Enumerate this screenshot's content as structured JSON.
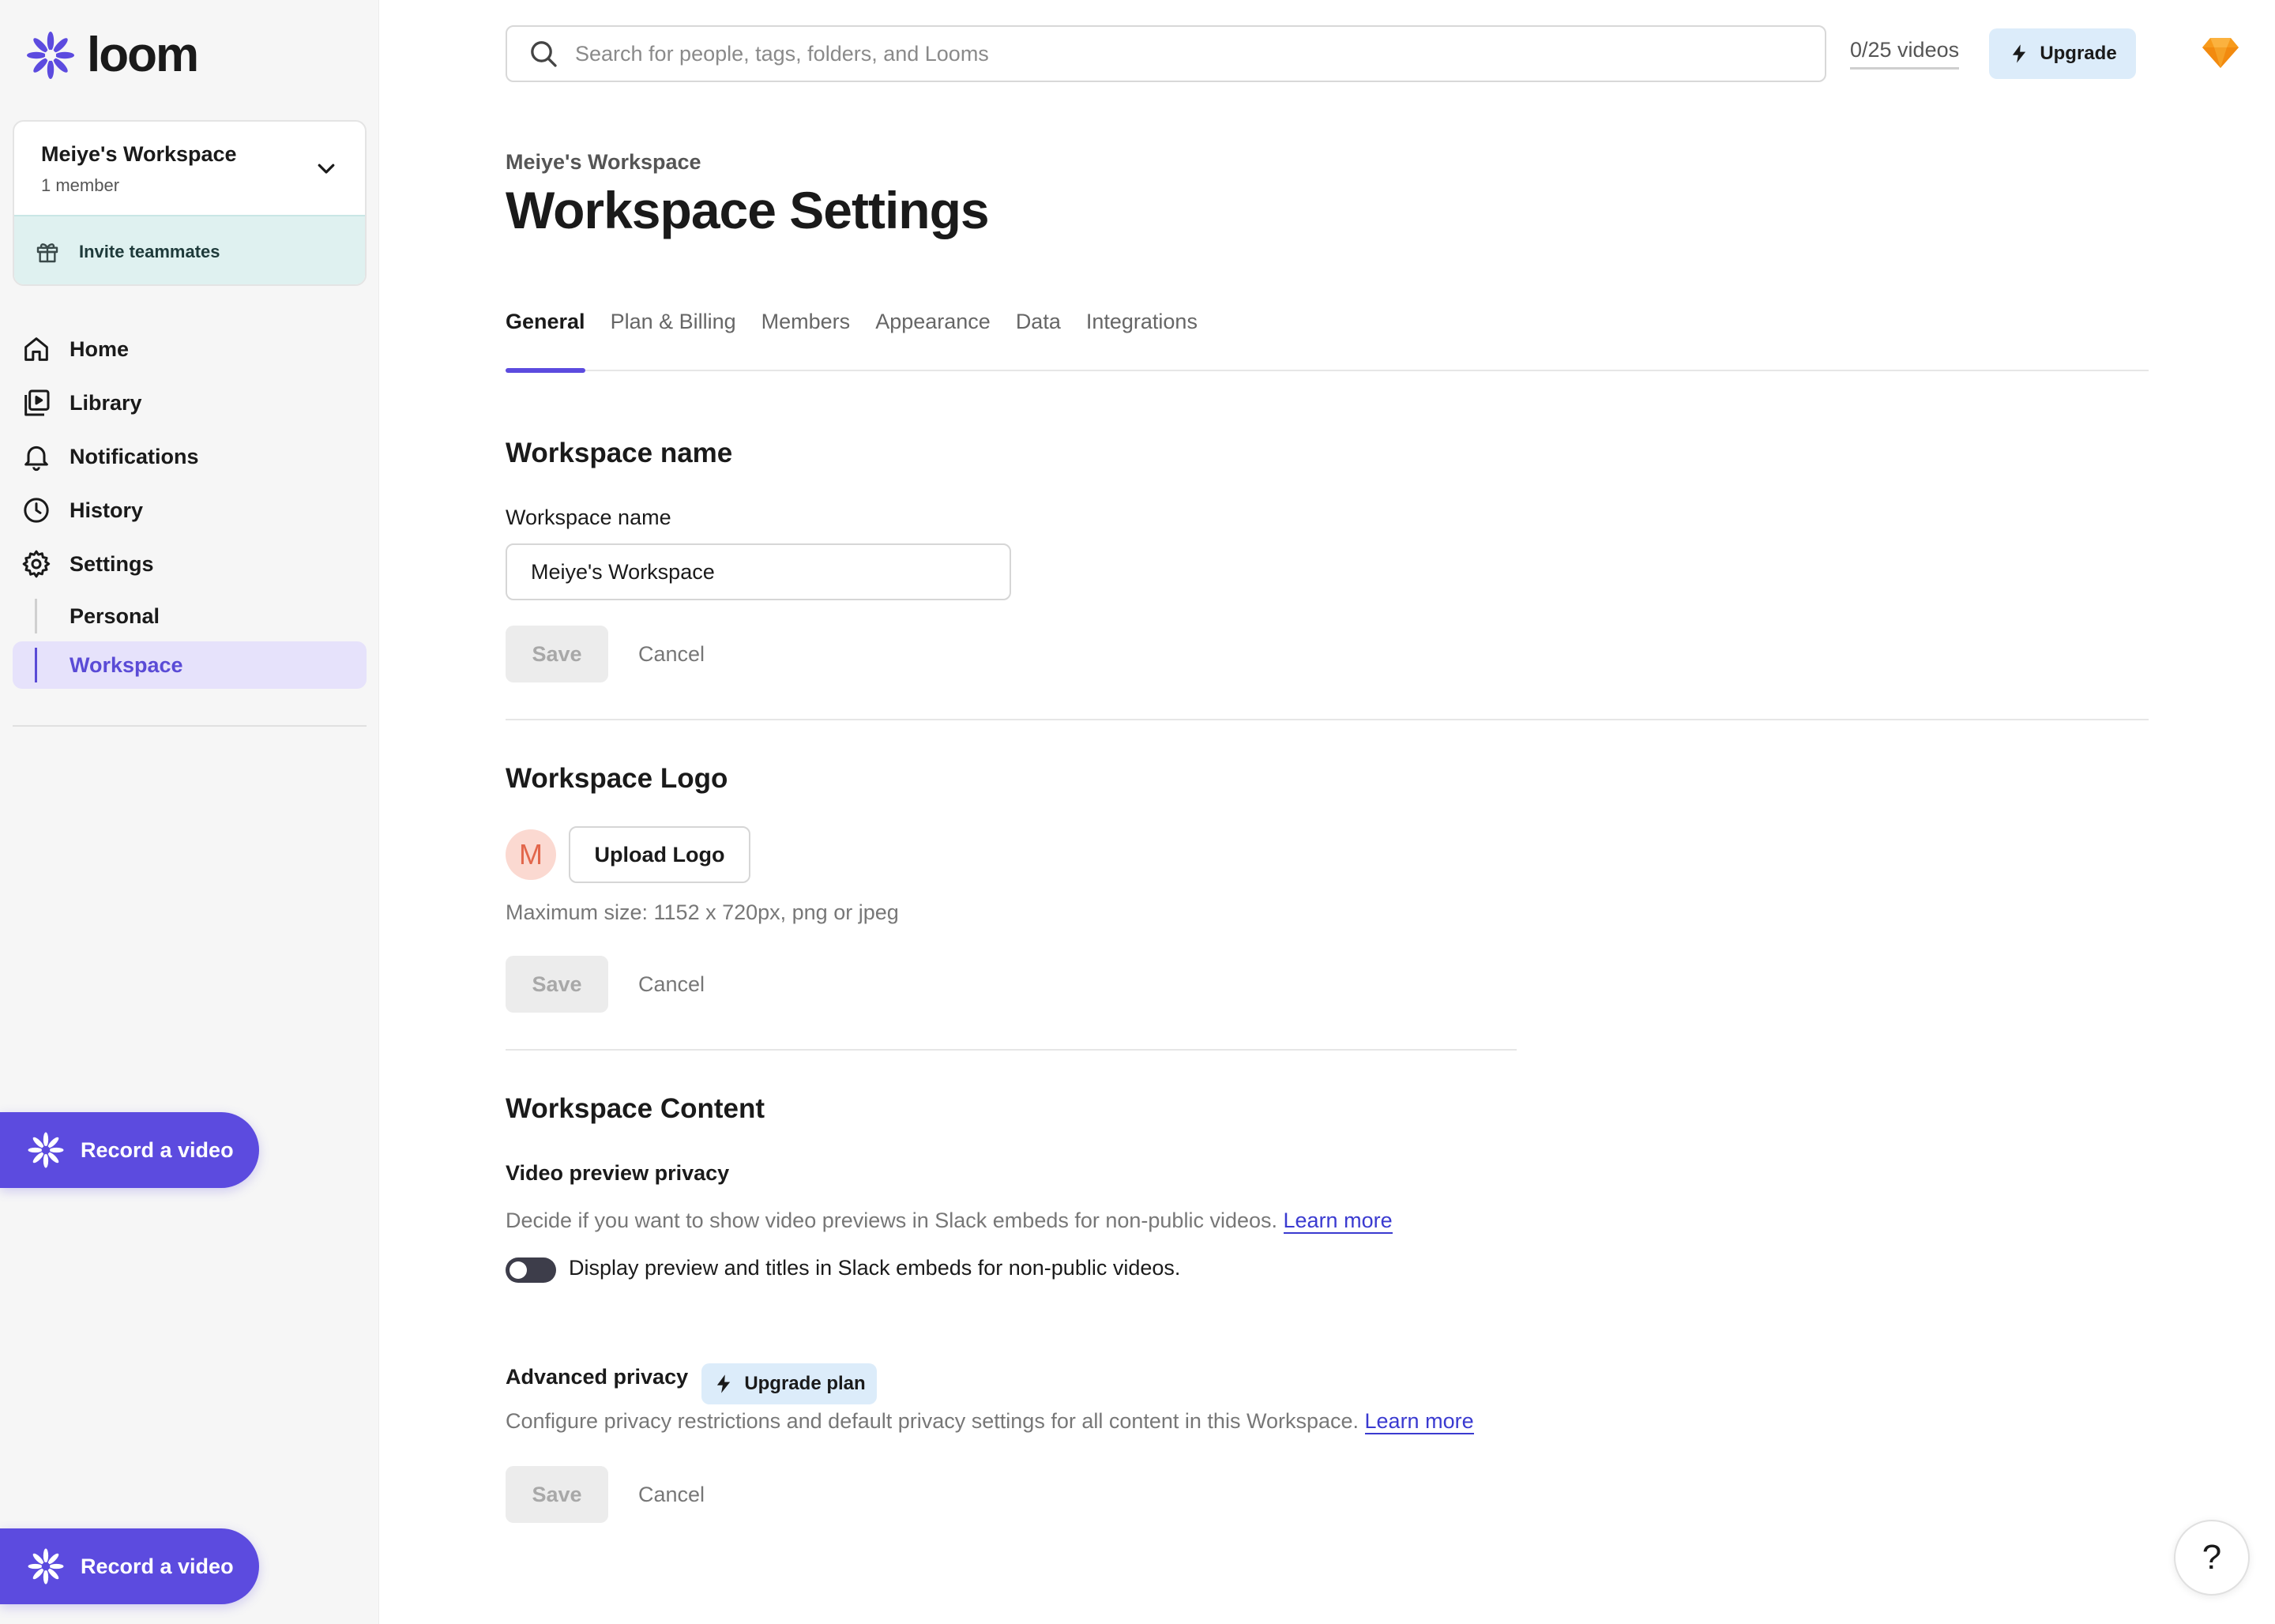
{
  "brand": {
    "name": "loom",
    "accent": "#5c4bdf"
  },
  "workspace_card": {
    "name": "Meiye's Workspace",
    "members": "1 member",
    "invite_label": "Invite teammates"
  },
  "nav": {
    "home": "Home",
    "library": "Library",
    "notifications": "Notifications",
    "history": "History",
    "settings": "Settings",
    "personal": "Personal",
    "workspace": "Workspace"
  },
  "record_button": {
    "label": "Record a video"
  },
  "search": {
    "placeholder": "Search for people, tags, folders, and Looms"
  },
  "header": {
    "video_count": "0/25 videos",
    "upgrade_label": "Upgrade"
  },
  "page": {
    "breadcrumb": "Meiye's Workspace",
    "title": "Workspace Settings"
  },
  "tabs": [
    "General",
    "Plan & Billing",
    "Members",
    "Appearance",
    "Data",
    "Integrations"
  ],
  "active_tab": "General",
  "workspace_name_section": {
    "title": "Workspace name",
    "field_label": "Workspace name",
    "value": "Meiye's Workspace",
    "save": "Save",
    "cancel": "Cancel"
  },
  "workspace_logo_section": {
    "title": "Workspace Logo",
    "avatar_letter": "M",
    "upload_label": "Upload Logo",
    "hint": "Maximum size: 1152 x 720px, png or jpeg",
    "save": "Save",
    "cancel": "Cancel"
  },
  "workspace_content_section": {
    "title": "Workspace Content",
    "preview_privacy": {
      "label": "Video preview privacy",
      "description": "Decide if you want to show video previews in Slack embeds for non-public videos.",
      "learn_more": "Learn more",
      "toggle_label": "Display preview and titles in Slack embeds for non-public videos.",
      "toggle_on": false
    },
    "advanced_privacy": {
      "label": "Advanced privacy",
      "upgrade_plan": "Upgrade plan",
      "description": "Configure privacy restrictions and default privacy settings for all content in this Workspace.",
      "learn_more": "Learn more"
    },
    "save": "Save",
    "cancel": "Cancel"
  },
  "help": {
    "label": "?"
  },
  "icons": {
    "logo": "loom-burst-icon",
    "chevron": "chevron-down-icon",
    "gift": "gift-icon",
    "home": "home-icon",
    "library": "library-icon",
    "notifications": "bell-icon",
    "history": "clock-icon",
    "settings": "gear-icon",
    "search": "search-icon",
    "bolt": "lightning-icon",
    "gem": "gem-icon"
  }
}
